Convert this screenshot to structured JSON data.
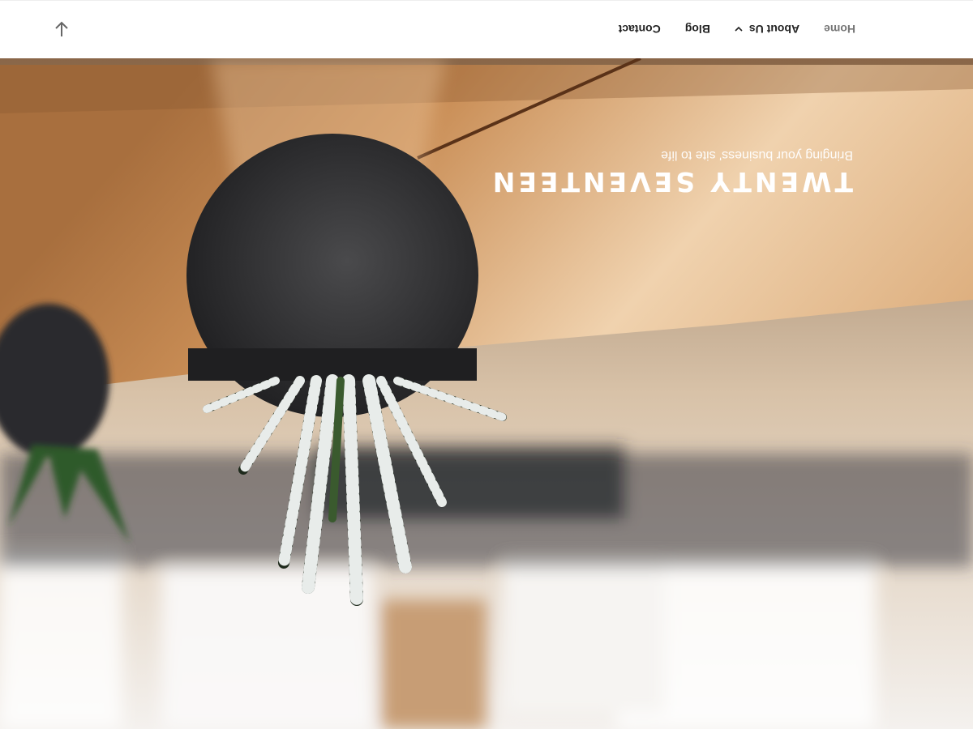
{
  "site": {
    "title": "Twenty Seventeen",
    "description": "Bringing your business' site to life"
  },
  "nav": {
    "items": [
      {
        "label": "Home",
        "current": true
      },
      {
        "label": "About Us",
        "has_submenu": true
      },
      {
        "label": "Blog"
      },
      {
        "label": "Contact"
      }
    ],
    "submenu_icon": "chevron-down-icon",
    "scroll_icon": "arrow-down-icon"
  },
  "colors": {
    "nav_background": "#ffffff",
    "nav_text": "#222222",
    "nav_current": "#767676",
    "title_text": "#ffffff"
  }
}
